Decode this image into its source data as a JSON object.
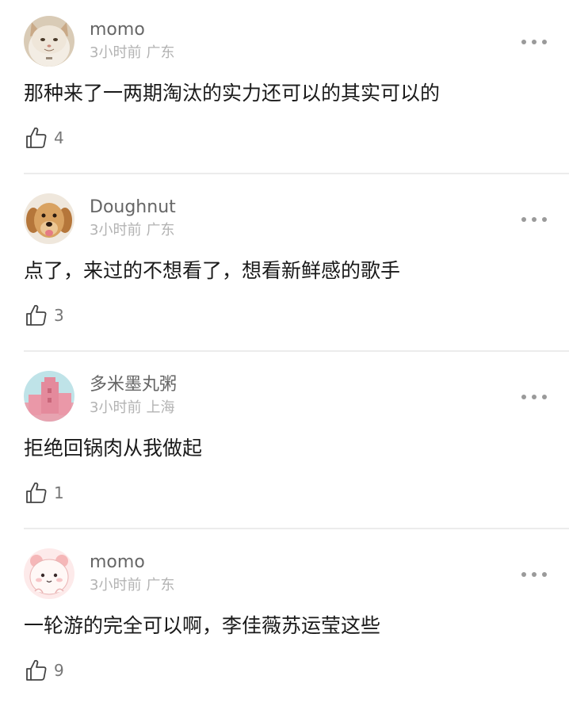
{
  "comments": [
    {
      "username": "momo",
      "time": "3小时前",
      "location": "广东",
      "text": "那种来了一两期淘汰的实力还可以的其实可以的",
      "likes": "4",
      "avatar": "cat-avatar"
    },
    {
      "username": "Doughnut",
      "time": "3小时前",
      "location": "广东",
      "text": "点了，来过的不想看了，想看新鲜感的歌手",
      "likes": "3",
      "avatar": "dog-avatar"
    },
    {
      "username": "多米墨丸粥",
      "time": "3小时前",
      "location": "上海",
      "text": "拒绝回锅肉从我做起",
      "likes": "1",
      "avatar": "pink-building-avatar"
    },
    {
      "username": "momo",
      "time": "3小时前",
      "location": "广东",
      "text": "一轮游的完全可以啊，李佳薇苏运莹这些",
      "likes": "9",
      "avatar": "cartoon-bear-avatar"
    }
  ],
  "icons": {
    "like": "thumbs-up-icon",
    "more": "more-options-icon"
  }
}
